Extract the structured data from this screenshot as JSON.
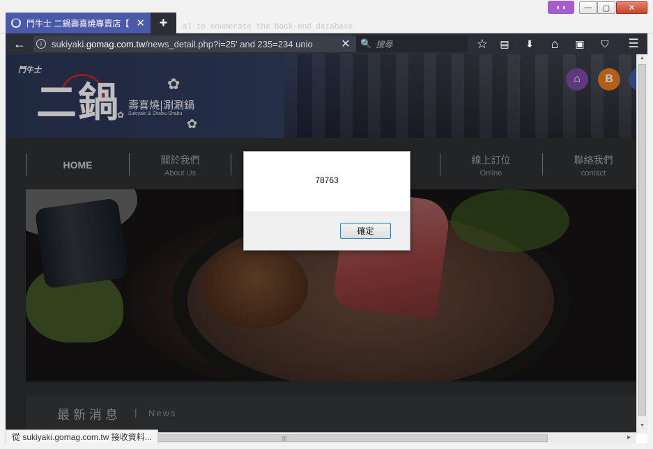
{
  "browser": {
    "tab_title": "鬥牛士 二鍋壽喜燒專賣店【",
    "tab_close": "✕",
    "new_tab": "+",
    "ghost_text": "al to enumerate the back-end database",
    "url_prefix": "sukiyaki.",
    "url_host": "gomag.com.tw",
    "url_path": "/news_detail.php?i=25' and 235=234 unio",
    "url_clear": "✕",
    "search_placeholder": "搜尋",
    "status_text": "從 sukiyaki.gomag.com.tw 接收資料...",
    "icons": {
      "back": "←",
      "info": "i",
      "bookmark": "☆",
      "reading_list": "▤",
      "download": "⬇",
      "home": "⌂",
      "sidebar": "▣",
      "pocket": "⛉",
      "menu": "☰",
      "search": "🔍",
      "mask": "◐◑",
      "minimize": "—",
      "maximize": "▢",
      "close": "✕"
    },
    "colors": {
      "tab_active": "#4a5aa8",
      "toolbar": "#2b2e36",
      "private_mask": "#a55ccc"
    }
  },
  "page": {
    "brand_small": "鬥牛士",
    "brand_big": "二鍋",
    "brand_sub": "壽喜燒|涮涮鍋",
    "brand_en": "Sukiyaki & Shabu-Shabu",
    "menu": [
      {
        "zh": "",
        "en": "HOME"
      },
      {
        "zh": "關於我們",
        "en": "About Us"
      },
      {
        "zh": "線上訂位",
        "en": "Online"
      },
      {
        "zh": "聯絡我們",
        "en": "contact"
      }
    ],
    "news_zh": "最新消息",
    "news_sep": "|",
    "news_en": "News",
    "social_icons": [
      "home-icon",
      "blogger-icon",
      "facebook-icon"
    ]
  },
  "dialog": {
    "message": "78763",
    "ok_label": "確定"
  }
}
